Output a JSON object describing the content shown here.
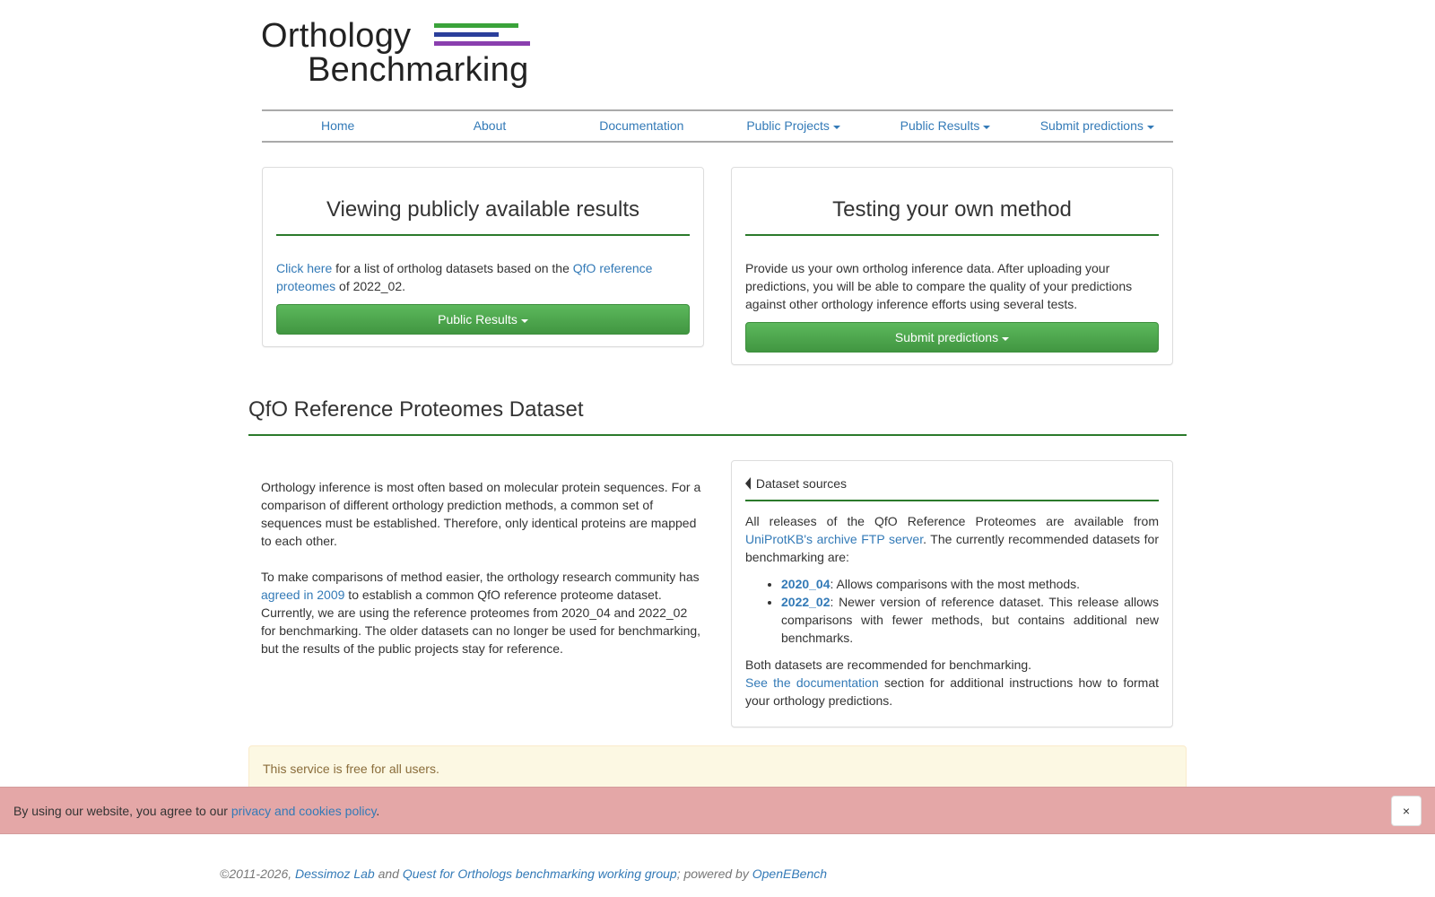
{
  "logo": {
    "line1": "Orthology",
    "line2": "Benchmarking",
    "bar_colors": [
      "#3aa33a",
      "#2b3f9b",
      "#8a3fae"
    ]
  },
  "nav": {
    "home": "Home",
    "about": "About",
    "documentation": "Documentation",
    "public_projects": "Public Projects",
    "public_results": "Public Results",
    "submit_predictions": "Submit predictions"
  },
  "panel_public": {
    "title": "Viewing publicly available results",
    "link_click_here": "Click here",
    "text_mid": " for a list of ortholog datasets based on the ",
    "link_qfo": "QfO reference proteomes",
    "text_end": " of 2022_02.",
    "button": "Public Results"
  },
  "panel_own": {
    "title": "Testing your own method",
    "text": "Provide us your own ortholog inference data. After uploading your predictions, you will be able to compare the quality of your predictions against other orthology inference efforts using several tests.",
    "button": "Submit predictions"
  },
  "section": {
    "title": "QfO Reference Proteomes Dataset",
    "para1": "Orthology inference is most often based on molecular protein sequences. For a comparison of different orthology prediction methods, a common set of sequences must be established. Therefore, only identical proteins are mapped to each other.",
    "para2_start": "To make comparisons of method easier, the orthology research community has ",
    "para2_link": "agreed in 2009",
    "para2_end": " to establish a common QfO reference proteome dataset. Currently, we are using the reference proteomes from 2020_04 and 2022_02 for benchmarking. The older datasets can no longer be used for benchmarking, but the results of the public projects stay for reference."
  },
  "sources": {
    "header": "Dataset sources",
    "intro_start": "All releases of the QfO Reference Proteomes are available from ",
    "intro_link": "UniProtKB's archive FTP server",
    "intro_end": ". The currently recommended datasets for benchmarking are:",
    "items": [
      {
        "name": "2020_04",
        "desc": ": Allows comparisons with the most methods."
      },
      {
        "name": "2022_02",
        "desc": ": Newer version of reference dataset. This release allows comparisons with fewer methods, but contains additional new benchmarks."
      }
    ],
    "both": "Both datasets are recommended for benchmarking.",
    "doc_link": "See the documentation",
    "doc_end": " section for additional instructions how to format your orthology predictions."
  },
  "alert": {
    "line1": "This service is free for all users."
  },
  "cookie": {
    "text": "By using our website, you agree to our ",
    "link": "privacy and cookies policy",
    "end": ".",
    "close": "×"
  },
  "footer": {
    "copyright": "©2011-2026, ",
    "lab": "Dessimoz Lab",
    "and": " and ",
    "group": "Quest for Orthologs benchmarking working group",
    "powered": "; powered by ",
    "openebench": "OpenEBench"
  }
}
